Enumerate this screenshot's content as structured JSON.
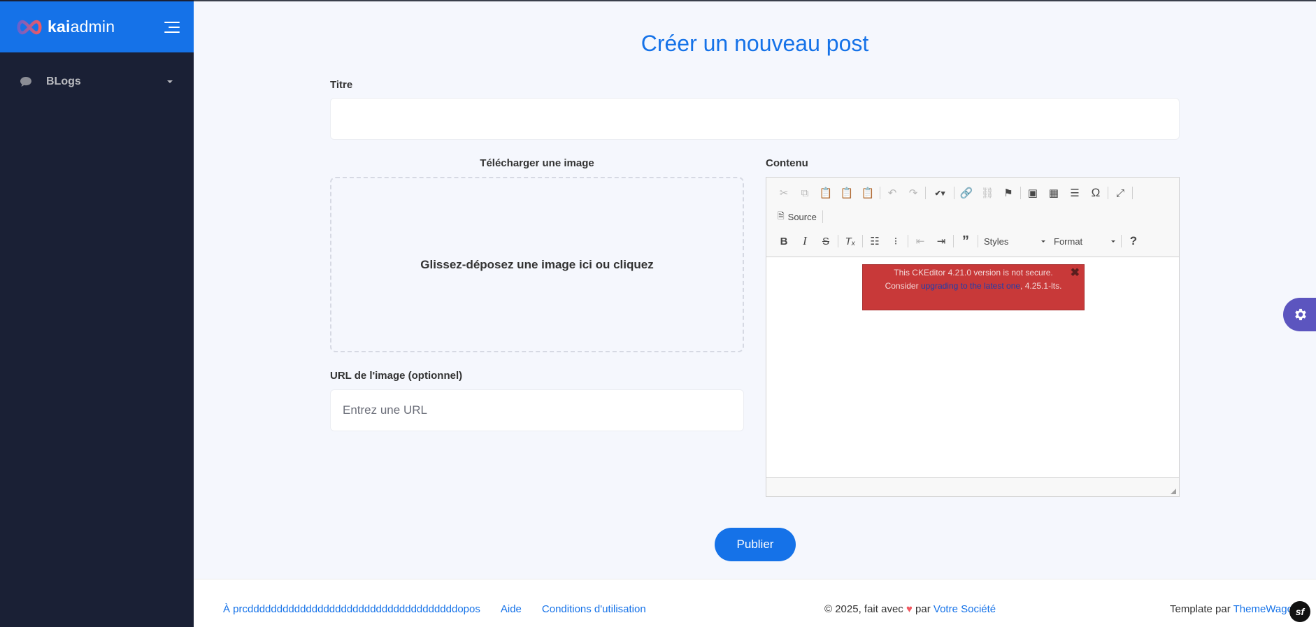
{
  "sidebar": {
    "logo_bold": "kai",
    "logo_rest": "admin",
    "items": [
      {
        "label": "BLogs",
        "icon": "comment-icon"
      }
    ]
  },
  "main": {
    "title": "Créer un nouveau post",
    "title_label": "Titre",
    "title_value": "",
    "upload_label": "Télécharger une image",
    "dropzone_text": "Glissez-déposez une image ici ou cliquez",
    "url_label": "URL de l'image (optionnel)",
    "url_placeholder": "Entrez une URL",
    "content_label": "Contenu",
    "publish_label": "Publier"
  },
  "editor": {
    "source_label": "Source",
    "styles_label": "Styles",
    "format_label": "Format",
    "warning_pre": "This CKEditor 4.21.0 version is not secure. Consider",
    "warning_link": "upgrading to the latest one",
    "warning_post": ", 4.25.1-lts.",
    "warning_close": "✖"
  },
  "footer": {
    "link1": "À prcddddddddddddddddddddddddddddddddddddopos",
    "link2": "Aide",
    "link3": "Conditions d'utilisation",
    "copyright_pre": "© 2025, fait avec",
    "heart": "♥",
    "copyright_mid": "par",
    "company": "Votre Société",
    "template_pre": "Template par",
    "template_link": "ThemeWagon"
  },
  "colors": {
    "primary": "#1572e8",
    "sidebar_bg": "#1a2035",
    "warning_bg": "#c83939",
    "gear_bg": "#5c55bf"
  }
}
